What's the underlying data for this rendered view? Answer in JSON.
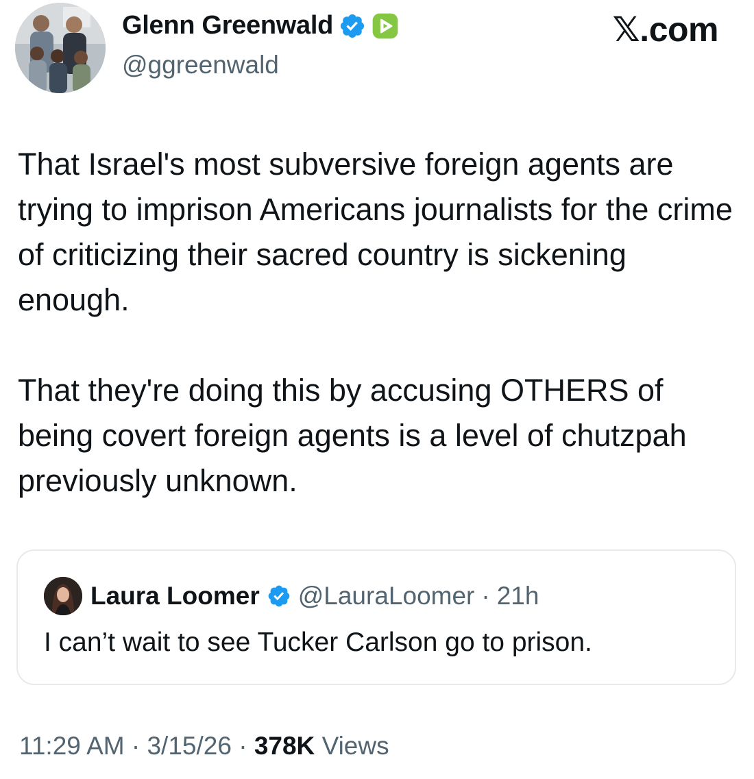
{
  "author": {
    "name": "Glenn Greenwald",
    "handle": "@ggreenwald",
    "verified_icon": "verified-badge-icon",
    "extra_badge_icon": "rumble-play-icon"
  },
  "site_label": "𝕏.com",
  "tweet": {
    "paragraphs": [
      "That Israel's most subversive foreign agents are trying to imprison Americans journalists for the crime of criticizing their sacred country is sickening enough.",
      "That they're doing this by accusing OTHERS of being covert foreign agents is a level of chutzpah previously unknown."
    ]
  },
  "quote": {
    "name": "Laura Loomer",
    "handle": "@LauraLoomer",
    "separator": "·",
    "time": "21h",
    "text": "I can’t wait to see Tucker Carlson go to prison."
  },
  "meta": {
    "time": "11:29 AM",
    "separator": "·",
    "date": "3/15/26",
    "views_count": "378K",
    "views_label": "Views"
  },
  "colors": {
    "text": "#0f1419",
    "secondary": "#536471",
    "verified_blue": "#1d9bf0",
    "rumble_green": "#85c742",
    "card_border": "#e7e9ec"
  }
}
